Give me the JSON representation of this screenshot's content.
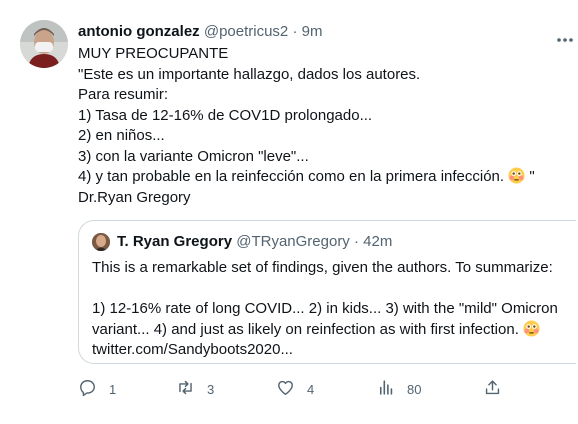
{
  "tweet": {
    "display_name": "antonio gonzalez",
    "handle": "@poetricus2",
    "separator": "·",
    "time": "9m",
    "lines": [
      "MUY PREOCUPANTE",
      "\"Este es un importante hallazgo, dados los autores.",
      "Para resumir:",
      "1) Tasa de 12-16% de COV1D prolongado...",
      "2) en niños...",
      "3) con la variante Omicron \"leve\"...",
      "4) y tan probable en la reinfección como en la primera infección.",
      "Dr.Ryan Gregory"
    ],
    "line7_tail": " \""
  },
  "quoted": {
    "display_name": "T. Ryan Gregory",
    "handle": "@TRyanGregory",
    "separator": "·",
    "time": "42m",
    "line1": "This is a remarkable set of findings, given the authors. To summarize:",
    "line2": "1) 12-16% rate of long COVID... 2) in kids... 3) with the \"mild\" Omicron",
    "line3": "variant... 4) and just as likely on reinfection as with first infection.",
    "line4": "twitter.com/Sandyboots2020..."
  },
  "actions": {
    "reply_count": "1",
    "retweet_count": "3",
    "like_count": "4",
    "views_count": "80"
  },
  "icons": {
    "reply": "reply-icon",
    "retweet": "retweet-icon",
    "like": "heart-icon",
    "views": "analytics-icon",
    "share": "share-icon",
    "more": "more-icon",
    "emoji": "flushed-face-emoji"
  },
  "colors": {
    "text": "#0f1419",
    "secondary": "#536471",
    "border": "#cfd9de"
  }
}
